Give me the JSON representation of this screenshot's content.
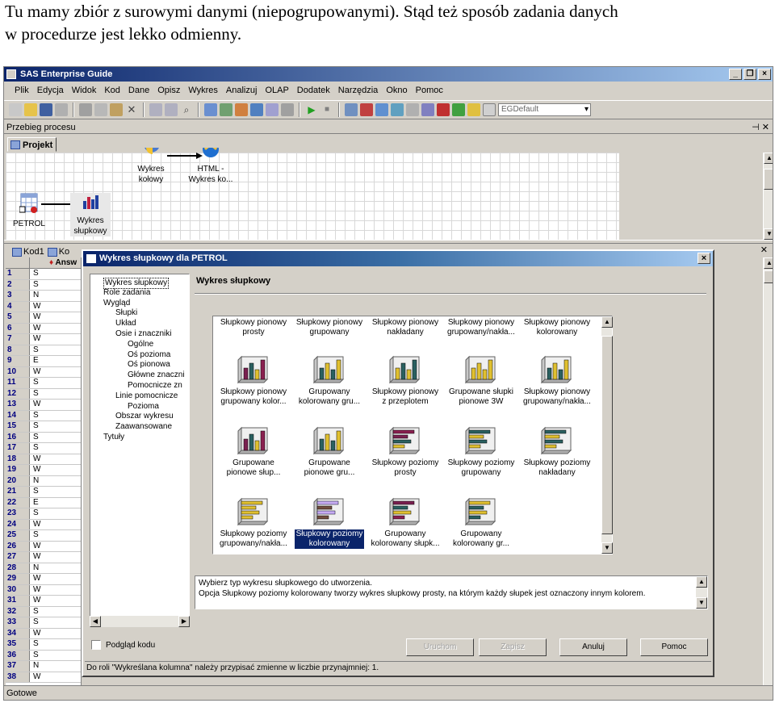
{
  "caption": {
    "line1": "Tu mamy zbiór z surowymi danymi (niepogrupowanymi). Stąd też sposób zadania danych",
    "line2": "w procedurze jest lekko odmienny."
  },
  "app": {
    "title": "SAS Enterprise Guide",
    "menu": [
      "Plik",
      "Edycja",
      "Widok",
      "Kod",
      "Dane",
      "Opisz",
      "Wykres",
      "Analizuj",
      "OLAP",
      "Dodatek",
      "Narzędzia",
      "Okno",
      "Pomoc"
    ],
    "style_combo": "EGDefault",
    "process_pane_title": "Przebieg procesu",
    "project_tab": "Projekt",
    "nodes": {
      "pie_chart": "Wykres kołowy",
      "html_output": "HTML - Wykres ko...",
      "petrol": "PETROL",
      "bar_chart": "Wykres słupkowy"
    },
    "code_tabs": [
      "Kod1",
      "Ko"
    ],
    "sheet": {
      "column": "Answ",
      "rows": [
        {
          "n": "1",
          "v": "S"
        },
        {
          "n": "2",
          "v": "S"
        },
        {
          "n": "3",
          "v": "N"
        },
        {
          "n": "4",
          "v": "W"
        },
        {
          "n": "5",
          "v": "W"
        },
        {
          "n": "6",
          "v": "W"
        },
        {
          "n": "7",
          "v": "W"
        },
        {
          "n": "8",
          "v": "S"
        },
        {
          "n": "9",
          "v": "E"
        },
        {
          "n": "10",
          "v": "W"
        },
        {
          "n": "11",
          "v": "S"
        },
        {
          "n": "12",
          "v": "S"
        },
        {
          "n": "13",
          "v": "W"
        },
        {
          "n": "14",
          "v": "S"
        },
        {
          "n": "15",
          "v": "S"
        },
        {
          "n": "16",
          "v": "S"
        },
        {
          "n": "17",
          "v": "S"
        },
        {
          "n": "18",
          "v": "W"
        },
        {
          "n": "19",
          "v": "W"
        },
        {
          "n": "20",
          "v": "N"
        },
        {
          "n": "21",
          "v": "S"
        },
        {
          "n": "22",
          "v": "E"
        },
        {
          "n": "23",
          "v": "S"
        },
        {
          "n": "24",
          "v": "W"
        },
        {
          "n": "25",
          "v": "S"
        },
        {
          "n": "26",
          "v": "W"
        },
        {
          "n": "27",
          "v": "W"
        },
        {
          "n": "28",
          "v": "N"
        },
        {
          "n": "29",
          "v": "W"
        },
        {
          "n": "30",
          "v": "W"
        },
        {
          "n": "31",
          "v": "W"
        },
        {
          "n": "32",
          "v": "S"
        },
        {
          "n": "33",
          "v": "S"
        },
        {
          "n": "34",
          "v": "W"
        },
        {
          "n": "35",
          "v": "S"
        },
        {
          "n": "36",
          "v": "S"
        },
        {
          "n": "37",
          "v": "N"
        },
        {
          "n": "38",
          "v": "W"
        }
      ]
    },
    "status": "Gotowe"
  },
  "dialog": {
    "title": "Wykres słupkowy dla PETROL",
    "panel_title": "Wykres słupkowy",
    "tree": [
      {
        "label": "Wykres słupkowy",
        "level": 0,
        "selected": true
      },
      {
        "label": "Role zadania",
        "level": 0
      },
      {
        "label": "Wygląd",
        "level": 0
      },
      {
        "label": "Słupki",
        "level": 1
      },
      {
        "label": "Układ",
        "level": 1
      },
      {
        "label": "Osie i znaczniki",
        "level": 1
      },
      {
        "label": "Ogólne",
        "level": 2
      },
      {
        "label": "Oś pozioma",
        "level": 2
      },
      {
        "label": "Oś pionowa",
        "level": 2
      },
      {
        "label": "Główne znaczni",
        "level": 2
      },
      {
        "label": "Pomocnicze zn",
        "level": 2
      },
      {
        "label": "Linie pomocnicze",
        "level": 1
      },
      {
        "label": "Pozioma",
        "level": 2
      },
      {
        "label": "Obszar wykresu",
        "level": 1
      },
      {
        "label": "Zaawansowane",
        "level": 1
      },
      {
        "label": "Tytuły",
        "level": 0
      }
    ],
    "gallery_top_labels": [
      {
        "l1": "Słupkowy pionowy",
        "l2": "prosty"
      },
      {
        "l1": "Słupkowy pionowy",
        "l2": "grupowany"
      },
      {
        "l1": "Słupkowy pionowy",
        "l2": "nakładany"
      },
      {
        "l1": "Słupkowy pionowy",
        "l2": "grupowany/nakła..."
      },
      {
        "l1": "Słupkowy pionowy",
        "l2": "kolorowany"
      }
    ],
    "gallery": [
      {
        "l1": "Słupkowy pionowy",
        "l2": "grupowany kolor...",
        "icon": "vbar-group-color-icon"
      },
      {
        "l1": "Grupowany",
        "l2": "kolorowany gru...",
        "icon": "vbar-group-icon"
      },
      {
        "l1": "Słupkowy pionowy",
        "l2": "z przeplotem",
        "icon": "vbar-interleave-icon"
      },
      {
        "l1": "Grupowane słupki",
        "l2": "pionowe 3W",
        "icon": "vbar-3d-icon"
      },
      {
        "l1": "Słupkowy pionowy",
        "l2": "grupowany/nakła...",
        "icon": "vbar-stack-icon"
      },
      {
        "l1": "Grupowane",
        "l2": "pionowe słup...",
        "icon": "vbar-grouped-3d-icon"
      },
      {
        "l1": "Grupowane",
        "l2": "pionowe gru...",
        "icon": "vbar-grouped-2-icon"
      },
      {
        "l1": "Słupkowy poziomy",
        "l2": "prosty",
        "icon": "hbar-simple-icon"
      },
      {
        "l1": "Słupkowy poziomy",
        "l2": "grupowany",
        "icon": "hbar-group-icon"
      },
      {
        "l1": "Słupkowy poziomy",
        "l2": "nakładany",
        "icon": "hbar-stack-icon"
      },
      {
        "l1": "Słupkowy poziomy",
        "l2": "grupowany/nakła...",
        "icon": "hbar-group-stack-icon"
      },
      {
        "l1": "Słupkowy poziomy",
        "l2": "kolorowany",
        "icon": "hbar-color-icon",
        "selected": true
      },
      {
        "l1": "Grupowany",
        "l2": "kolorowany słupk...",
        "icon": "hbar-group-color-icon"
      },
      {
        "l1": "Grupowany",
        "l2": "kolorowany gr...",
        "icon": "hbar-group-color-2-icon"
      }
    ],
    "description_line1": "Wybierz typ wykresu słupkowego do utworzenia.",
    "description_line2": "Opcja Słupkowy poziomy kolorowany tworzy wykres słupkowy prosty, na którym każdy słupek jest oznaczony innym kolorem.",
    "preview_code": "Podgląd kodu",
    "buttons": {
      "run": "Uruchom",
      "save": "Zapisz",
      "cancel": "Anuluj",
      "help": "Pomoc"
    },
    "status": "Do roli \"Wykreślana kolumna\" należy przypisać zmienne w liczbie przynajmniej: 1."
  },
  "colors": {
    "selection": "#0a246a",
    "titlebar": "#0a246a",
    "face": "#d4d0c8"
  }
}
